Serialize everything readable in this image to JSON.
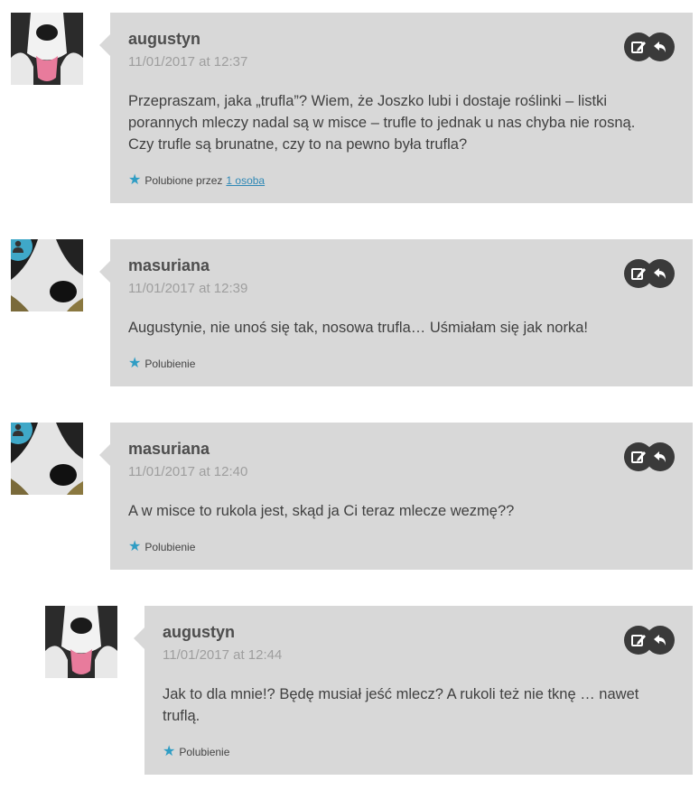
{
  "comments": [
    {
      "author": "augustyn",
      "date": "11/01/2017 at 12:37",
      "text_lines": [
        "Przepraszam, jaka „trufla”? Wiem, że Joszko lubi i dostaje roślinki – listki",
        "porannych mleczy nadal są w misce – trufle to jednak u nas chyba nie rosną.",
        "Czy trufle są brunatne, czy to na pewno była trufla?"
      ],
      "like_text": "Polubione przez",
      "like_link": "1 osoba"
    },
    {
      "author": "masuriana",
      "date": "11/01/2017 at 12:39",
      "text_lines": [
        "Augustynie, nie unoś się tak, nosowa trufla… Uśmiałam się jak norka!"
      ],
      "like_text": "Polubienie"
    },
    {
      "author": "masuriana",
      "date": "11/01/2017 at 12:40",
      "text_lines": [
        "A w misce to rukola jest, skąd ja Ci teraz mlecze wezmę??"
      ],
      "like_text": "Polubienie"
    },
    {
      "author": "augustyn",
      "date": "11/01/2017 at 12:44",
      "text_lines": [
        "Jak to dla mnie!? Będę musiał jeść mlecz? A rukoli też nie tknę … nawet",
        "truflą."
      ],
      "like_text": "Polubienie"
    }
  ],
  "icons": {
    "edit": "edit-icon",
    "reply": "reply-icon",
    "star": "star-icon",
    "author_badge": "user-icon"
  },
  "colors": {
    "bubble": "#d8d8d8",
    "accent": "#2f9dc4",
    "badge": "#3fa8c8",
    "action": "#3a3a3a"
  }
}
